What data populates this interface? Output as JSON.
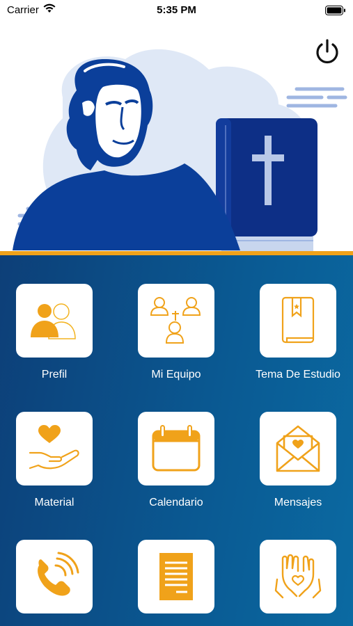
{
  "status_bar": {
    "carrier": "Carrier",
    "time": "5:35 PM"
  },
  "colors": {
    "accent": "#f0a21a",
    "brand_blue": "#0d3f78",
    "illustration_blue": "#0b3f9a",
    "book_blue": "#0d2f86"
  },
  "menu": {
    "items": [
      {
        "label": "Prefil",
        "icon": "people-icon"
      },
      {
        "label": "Mi Equipo",
        "icon": "team-icon"
      },
      {
        "label": "Tema De Estudio",
        "icon": "bookmark-book-icon"
      },
      {
        "label": "Material",
        "icon": "heart-hand-icon"
      },
      {
        "label": "Calendario",
        "icon": "calendar-icon"
      },
      {
        "label": "Mensajes",
        "icon": "envelope-icon"
      },
      {
        "label": "",
        "icon": "phone-icon"
      },
      {
        "label": "",
        "icon": "document-icon"
      },
      {
        "label": "",
        "icon": "praying-hands-icon"
      }
    ]
  }
}
